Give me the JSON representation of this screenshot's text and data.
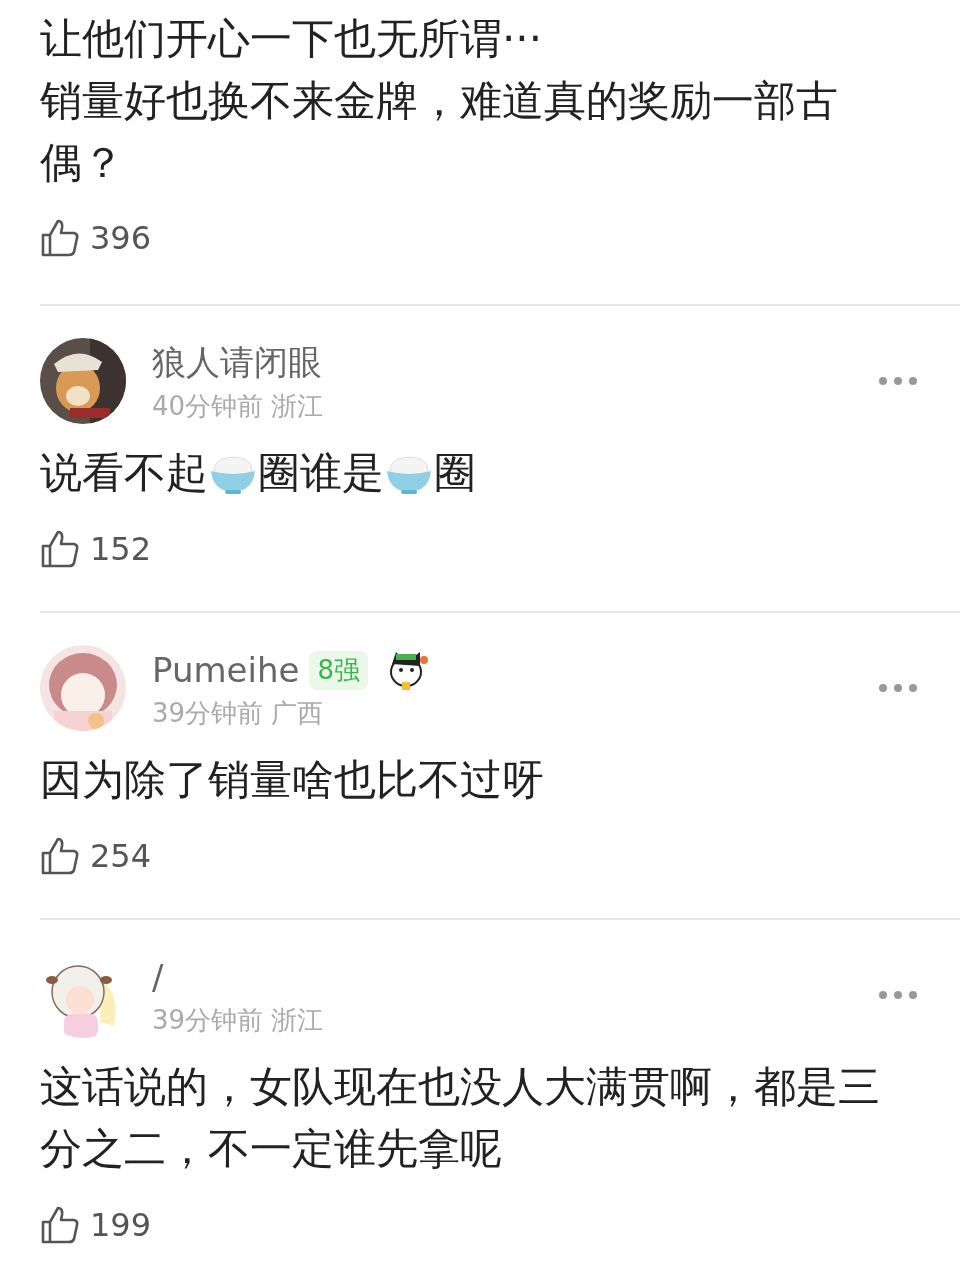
{
  "comments": [
    {
      "segments": [
        {
          "kind": "text",
          "text": "让他们开心一下也无所谓···\n销量好也换不来金牌，难道真的奖励一部古偶？"
        }
      ],
      "likes": "396"
    },
    {
      "author": {
        "name": "狼人请闭眼",
        "time": "40分钟前",
        "region": "浙江"
      },
      "segments": [
        {
          "kind": "text",
          "text": "说看不起"
        },
        {
          "kind": "emoji"
        },
        {
          "kind": "text",
          "text": "圈谁是"
        },
        {
          "kind": "emoji"
        },
        {
          "kind": "text",
          "text": "圈"
        }
      ],
      "likes": "152"
    },
    {
      "author": {
        "name": "Pumeihe",
        "badge": "8强",
        "sticker": true,
        "time": "39分钟前",
        "region": "广西"
      },
      "segments": [
        {
          "kind": "text",
          "text": "因为除了销量啥也比不过呀"
        }
      ],
      "likes": "254"
    },
    {
      "author": {
        "name": "/",
        "time": "39分钟前",
        "region": "浙江"
      },
      "segments": [
        {
          "kind": "text",
          "text": "这话说的，女队现在也没人大满贯啊，都是三分之二，不一定谁先拿呢"
        }
      ],
      "likes": "199"
    }
  ]
}
